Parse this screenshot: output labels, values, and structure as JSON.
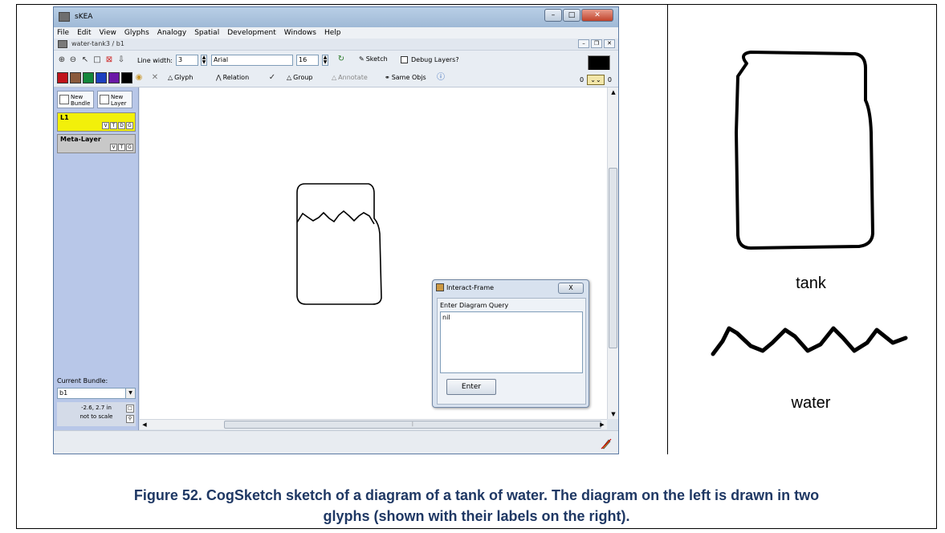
{
  "app": {
    "title": "sKEA",
    "menu": [
      "File",
      "Edit",
      "View",
      "Glyphs",
      "Analogy",
      "Spatial",
      "Development",
      "Windows",
      "Help"
    ],
    "document_title": "water-tank3 / b1"
  },
  "toolbar": {
    "line_width_label": "Line width:",
    "line_width_value": "3",
    "font_value": "Arial",
    "font_size_value": "16",
    "sketch_label": "Sketch",
    "debug_layers_label": "Debug Layers?",
    "glyph_label": "Glyph",
    "relation_label": "Relation",
    "group_label": "Group",
    "annotate_label": "Annotate",
    "same_objs_label": "Same Objs",
    "colors": [
      "#c0141c",
      "#8a5a3c",
      "#14873c",
      "#1c3fbf",
      "#6a18a6",
      "#000000"
    ],
    "zoom_left": "0",
    "zoom_right": "0"
  },
  "left_panel": {
    "new_bundle": "New Bundle",
    "new_layer": "New Layer",
    "layers": [
      {
        "name": "L1",
        "flags": [
          "V",
          "T",
          "D",
          "G"
        ],
        "color": "#f2f00a"
      },
      {
        "name": "Meta-Layer",
        "flags": [
          "V",
          "T",
          "G"
        ],
        "color": "#c8c8c8"
      }
    ],
    "current_bundle_label": "Current Bundle:",
    "current_bundle_value": "b1",
    "coords": "-2.6, 2.7 in",
    "scale_note": "not to scale"
  },
  "interact_frame": {
    "title": "Interact-Frame",
    "close": "X",
    "prompt": "Enter Diagram Query",
    "value": "nil",
    "enter_button": "Enter"
  },
  "glyphs": [
    {
      "label": "tank"
    },
    {
      "label": "water"
    }
  ],
  "caption": {
    "line1": "Figure 52. CogSketch sketch of a diagram of a tank of water.  The diagram on the left is drawn in two",
    "line2": "glyphs (shown with their labels on the right)."
  }
}
